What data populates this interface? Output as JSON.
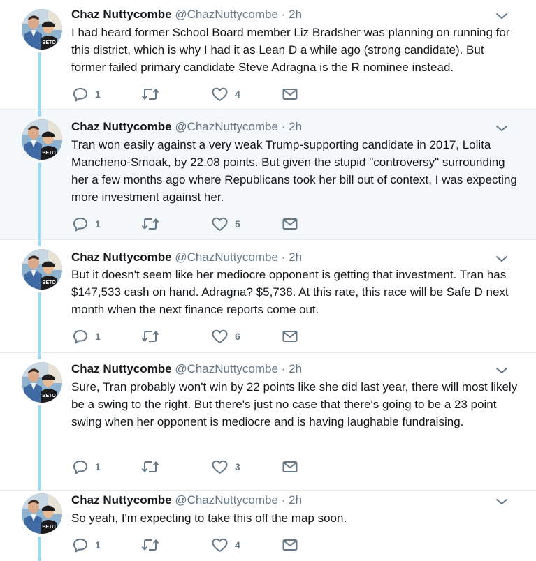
{
  "author": {
    "name": "Chaz Nuttycombe",
    "handle": "@ChazNuttycombe",
    "separator": "·",
    "avatar_shirt_text": "BETO"
  },
  "tweets": [
    {
      "time": "2h",
      "text": "I had heard former School Board member Liz Bradsher was planning on running for this district, which is why I had it as Lean D a while ago (strong candidate). But former failed primary candidate Steve Adragna is the R nominee instead.",
      "replies": "1",
      "retweets": "",
      "likes": "4"
    },
    {
      "time": "2h",
      "text": "Tran won easily against a very weak Trump-supporting candidate in 2017, Lolita Mancheno-Smoak, by 22.08 points. But given the stupid \"controversy\" surrounding her a few months ago where Republicans took her bill out of context, I was expecting more investment against her.",
      "replies": "1",
      "retweets": "",
      "likes": "5"
    },
    {
      "time": "2h",
      "text": "But it doesn't seem like her mediocre opponent is getting that investment. Tran has $147,533 cash on hand. Adragna? $5,738. At this rate, this race will be Safe D next month when the next finance reports come out.",
      "replies": "1",
      "retweets": "",
      "likes": "6"
    },
    {
      "time": "2h",
      "text": "Sure, Tran probably won't win by 22 points like she did last year, there will most likely be a swing to the right. But there's just no case that there's going to be a 23 point swing when her opponent is mediocre and is having laughable fundraising.",
      "replies": "1",
      "retweets": "",
      "likes": "3"
    },
    {
      "time": "2h",
      "text": "So yeah, I'm expecting to take this off the map soon.",
      "replies": "1",
      "retweets": "",
      "likes": "4"
    }
  ],
  "colors": {
    "text": "#14171a",
    "secondary": "#657786",
    "thread_line": "#a5d6f4",
    "highlight_bg": "#f5f8fa",
    "border": "#e6ecf0"
  },
  "icons": {
    "reply": "reply-icon",
    "retweet": "retweet-icon",
    "like": "heart-icon",
    "dm": "envelope-icon",
    "menu": "chevron-down-icon"
  }
}
